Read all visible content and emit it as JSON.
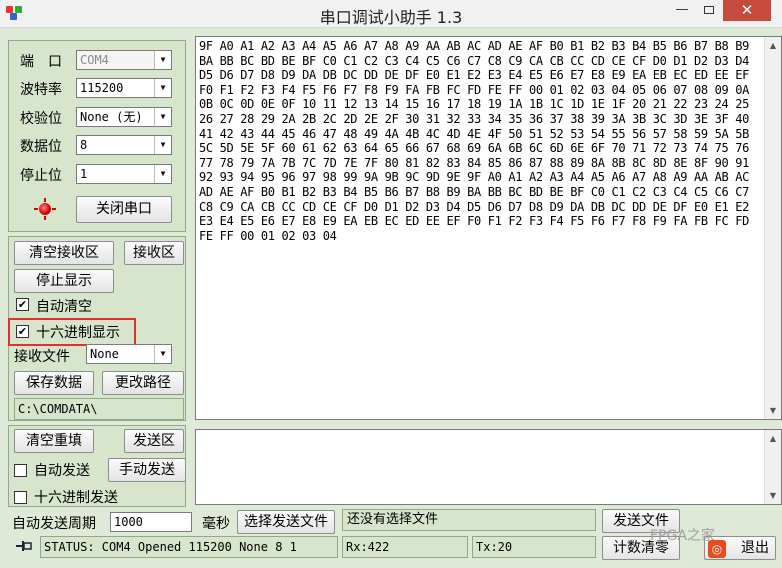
{
  "window": {
    "title": "串口调试小助手 1.3",
    "close_glyph": "✕",
    "minimize_glyph": "—"
  },
  "port_settings": {
    "port_label": "端　口",
    "port_value": "COM4",
    "baud_label": "波特率",
    "baud_value": "115200",
    "parity_label": "校验位",
    "parity_value": "None (无)",
    "databits_label": "数据位",
    "databits_value": "8",
    "stopbits_label": "停止位",
    "stopbits_value": "1",
    "toggle_port_label": "关闭串口",
    "indicator_color": "#e00000"
  },
  "receive_panel": {
    "clear_label": "清空接收区",
    "area_label": "接收区",
    "stop_label": "停止显示",
    "auto_clear_label": "自动清空",
    "auto_clear_checked": "✔",
    "hex_display_label": "十六进制显示",
    "hex_display_checked": "✔",
    "recv_file_label": "接收文件",
    "recv_file_value": "None",
    "save_label": "保存数据",
    "change_path_label": "更改路径",
    "path_value": "C:\\COMDATA\\"
  },
  "receive_data": "9F A0 A1 A2 A3 A4 A5 A6 A7 A8 A9 AA AB AC AD AE AF B0 B1 B2 B3 B4 B5 B6 B7 B8 B9 BA BB BC BD BE BF C0 C1 C2 C3 C4 C5 C6 C7 C8 C9 CA CB CC CD CE CF D0 D1 D2 D3 D4 D5 D6 D7 D8 D9 DA DB DC DD DE DF E0 E1 E2 E3 E4 E5 E6 E7 E8 E9 EA EB EC ED EE EF F0 F1 F2 F3 F4 F5 F6 F7 F8 F9 FA FB FC FD FE FF 00 01 02 03 04 05 06 07 08 09 0A 0B 0C 0D 0E 0F 10 11 12 13 14 15 16 17 18 19 1A 1B 1C 1D 1E 1F 20 21 22 23 24 25 26 27 28 29 2A 2B 2C 2D 2E 2F 30 31 32 33 34 35 36 37 38 39 3A 3B 3C 3D 3E 3F 40 41 42 43 44 45 46 47 48 49 4A 4B 4C 4D 4E 4F 50 51 52 53 54 55 56 57 58 59 5A 5B 5C 5D 5E 5F 60 61 62 63 64 65 66 67 68 69 6A 6B 6C 6D 6E 6F 70 71 72 73 74 75 76 77 78 79 7A 7B 7C 7D 7E 7F 80 81 82 83 84 85 86 87 88 89 8A 8B 8C 8D 8E 8F 90 91 92 93 94 95 96 97 98 99 9A 9B 9C 9D 9E 9F A0 A1 A2 A3 A4 A5 A6 A7 A8 A9 AA AB AC AD AE AF B0 B1 B2 B3 B4 B5 B6 B7 B8 B9 BA BB BC BD BE BF C0 C1 C2 C3 C4 C5 C6 C7 C8 C9 CA CB CC CD CE CF D0 D1 D2 D3 D4 D5 D6 D7 D8 D9 DA DB DC DD DE DF E0 E1 E2 E3 E4 E5 E6 E7 E8 E9 EA EB EC ED EE EF F0 F1 F2 F3 F4 F5 F6 F7 F8 F9 FA FB FC FD FE FF 00 01 02 03 04",
  "send_panel": {
    "clear_label": "清空重填",
    "area_label": "发送区",
    "auto_send_label": "自动发送",
    "manual_send_label": "手动发送",
    "hex_send_label": "十六进制发送",
    "period_label": "自动发送周期",
    "period_value": "1000",
    "ms_label": "毫秒",
    "select_file_label": "选择发送文件",
    "file_status": "还没有选择文件",
    "send_file_label": "发送文件",
    "clear_count_label": "计数清零",
    "exit_label": "退出",
    "exit_glyph": "◎"
  },
  "status_bar": {
    "status": "STATUS: COM4 Opened 115200 None  8 1",
    "rx": "Rx:422",
    "tx": "Tx:20"
  },
  "watermark": "FPGA之家",
  "colors": {
    "panel": "#d6e5cc",
    "client": "#dfe9d7",
    "highlight": "#e03030",
    "close": "#c74b3c"
  }
}
